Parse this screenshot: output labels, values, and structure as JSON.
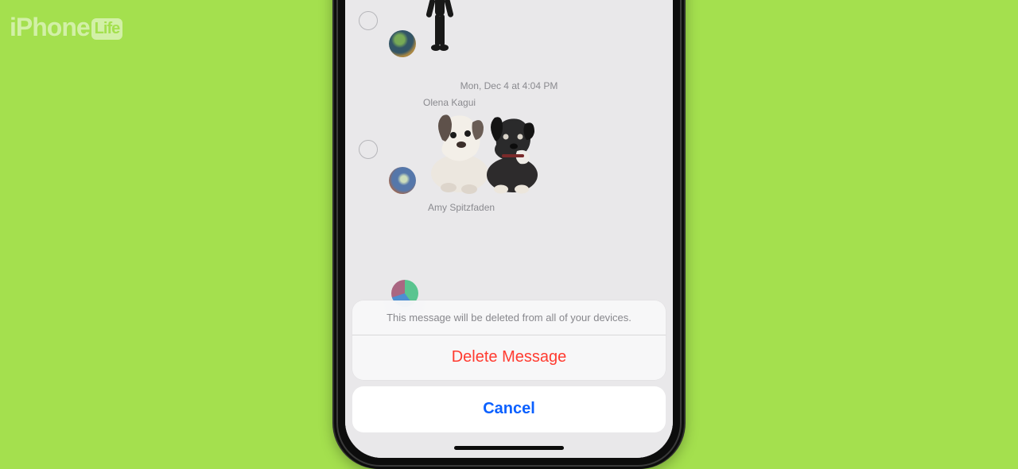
{
  "watermark": {
    "brand_left": "iPhone",
    "brand_box": "Life"
  },
  "chat": {
    "timestamp": "Mon, Dec 4 at 4:04 PM",
    "senders": [
      "Olena Kagui",
      "Amy Spitzfaden"
    ]
  },
  "action_sheet": {
    "message": "This message will be deleted from all of your devices.",
    "delete_label": "Delete Message",
    "cancel_label": "Cancel"
  },
  "colors": {
    "background": "#a4e04e",
    "danger": "#ff3b30",
    "primary": "#0a60ff"
  }
}
